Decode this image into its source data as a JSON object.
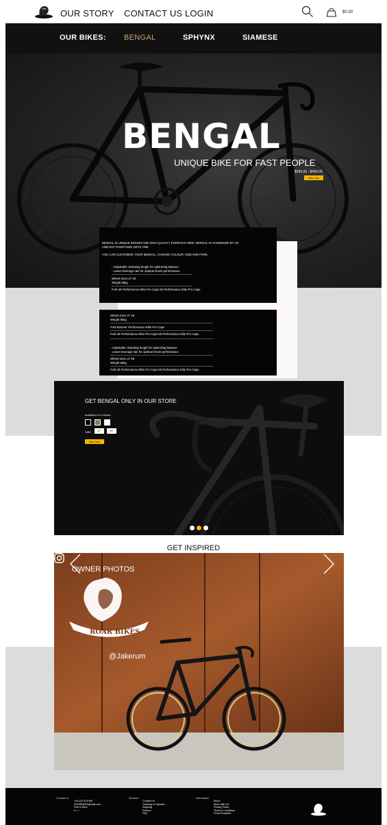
{
  "header": {
    "nav": [
      "OUR STORY",
      "CONTACT US",
      "LOGIN"
    ],
    "cart_total": "$0.00"
  },
  "bikes_nav": {
    "label": "OUR BIKES:",
    "items": [
      "BENGAL",
      "SPHYNX",
      "SIAMESE"
    ],
    "active": "BENGAL"
  },
  "hero": {
    "title": "BENGAL",
    "subtitle": "UNIQUE BIKE FOR FAST PEOPLE",
    "price": "$290.00 - $490.00",
    "buy_label": "Buy now"
  },
  "info_box_1": {
    "intro": "BENGAL IS UNIQUE DESIGN AND HIGH QUALITY EVERYDAY BIKE.  BENGAL IS HANDMADE BY US",
    "intro2": "AND NOT EVERYONE GETS ONE.",
    "customize": "YOU CAN CUSTOMIZE YOUR BENGAL. CHOOSE COLOUR, SIZE AND FORK.",
    "feature1": "- Adjustable chainstay length for optimizing balance",
    "feature2": "- Lower leverage rate for optimal shock performance",
    "wheel": "Wheel sizes  27     29",
    "weight": "Weight          55kg",
    "fork": "Fork   48 Performance Elite Pro Caps          55 Performance Elite Pro Caps"
  },
  "info_box_2": {
    "wheel": "Wheel sizes  27     29",
    "weight": "Weight          55kg",
    "fork_a": "Fork   Boomer Performance Elite Pro Caps",
    "fork_b": "Fork   48 Performance Elite Pro Caps          55 Performance Elite Pro Caps",
    "feature1": "- Adjustable chainstay length for optimizing balance",
    "feature2": "- Lower leverage rate for optimal shock performance",
    "wheel2": "Wheel sizes  27     29",
    "weight2": "Weight          55kg",
    "fork_c": "Fork   48 Performance Elite Pro Caps          55 Performance Elite Pro Caps"
  },
  "store": {
    "title": "GET BENGAL ONLY IN OUR STORE",
    "colours_label": "available in 3 colours",
    "swatches": [
      "#000000",
      "#8a7a5c",
      "#ffffff"
    ],
    "size_label": "SIZE",
    "sizes": [
      "47\"",
      "49\""
    ],
    "buy_label": "Buy now",
    "carousel_active": 2
  },
  "inspired": {
    "title": "GET INSPIRED",
    "owner_label": "OWNER PHOTOS",
    "brand": "ROAR BIKES",
    "handle": "@Jakerum"
  },
  "footer": {
    "contact_head": "Contact us",
    "contact": [
      "+44 222 678 960",
      "ROARBIKES@mail.com",
      "Find a Store"
    ],
    "services_head": "Services",
    "services": [
      "Contact Us",
      "Ordering & Payment",
      "Shipping",
      "Returns",
      "FAQ"
    ],
    "information_head": "Information",
    "information": [
      "About",
      "Work With US",
      "Privacy Policy",
      "Terms & Conditions",
      "Press Enquiries"
    ]
  }
}
